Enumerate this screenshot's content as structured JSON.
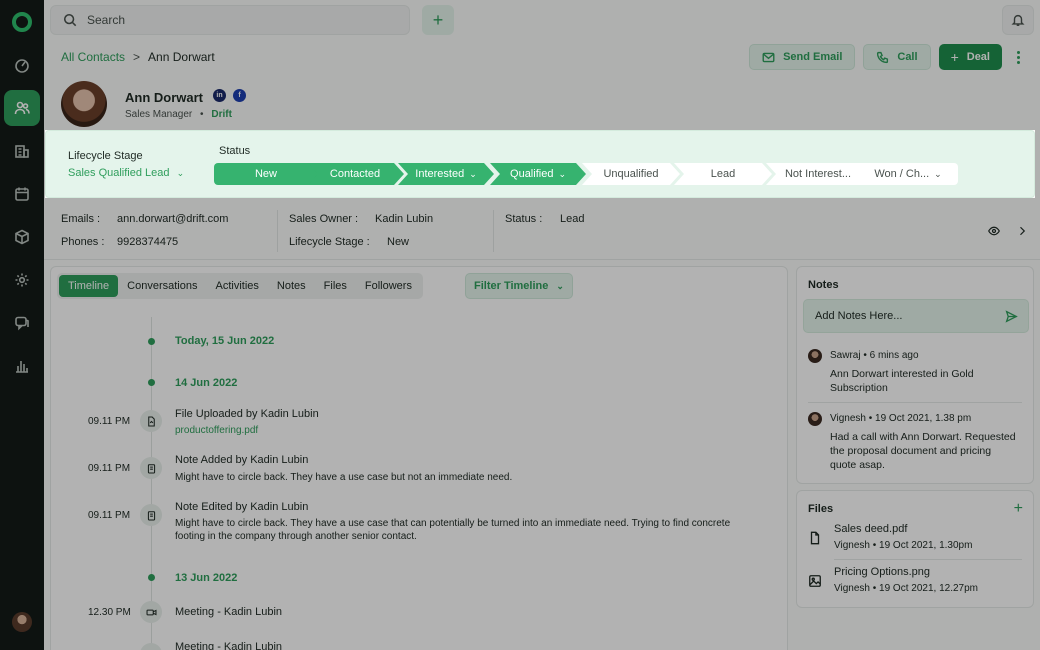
{
  "topbar": {
    "search_placeholder": "Search",
    "add_label": "+",
    "bell_icon": "bell-icon"
  },
  "breadcrumb": {
    "parent": "All Contacts",
    "separator": ">",
    "current": "Ann Dorwart"
  },
  "actions": {
    "send_email": "Send Email",
    "call": "Call",
    "deal": "Deal",
    "deal_plus": "+"
  },
  "profile": {
    "name": "Ann Dorwart",
    "role": "Sales Manager",
    "bullet": "•",
    "company": "Drift",
    "linkedin": "in",
    "facebook": "f"
  },
  "lifecycle": {
    "label": "Lifecycle Stage",
    "value": "Sales Qualified Lead",
    "status_label": "Status",
    "stages": [
      {
        "label": "New",
        "done": true,
        "dropdown": false
      },
      {
        "label": "Contacted",
        "done": true,
        "dropdown": false
      },
      {
        "label": "Interested",
        "done": true,
        "dropdown": true
      },
      {
        "label": "Qualified",
        "done": true,
        "dropdown": true
      },
      {
        "label": "Unqualified",
        "done": false,
        "dropdown": false
      },
      {
        "label": "Lead",
        "done": false,
        "dropdown": false
      },
      {
        "label": "Not Interest...",
        "done": false,
        "dropdown": false
      },
      {
        "label": "Won / Ch...",
        "done": false,
        "dropdown": true
      }
    ]
  },
  "info": {
    "emails_key": "Emails :",
    "emails_val": "ann.dorwart@drift.com",
    "phones_key": "Phones :",
    "phones_val": "9928374475",
    "owner_key": "Sales Owner :",
    "owner_val": "Kadin Lubin",
    "stage_key": "Lifecycle Stage :",
    "stage_val": "New",
    "status_key": "Status :",
    "status_val": "Lead"
  },
  "timeline": {
    "tabs": [
      "Timeline",
      "Conversations",
      "Activities",
      "Notes",
      "Files",
      "Followers"
    ],
    "filter_label": "Filter Timeline",
    "dates": [
      "Today, 15 Jun 2022",
      "14 Jun 2022",
      "13 Jun 2022"
    ],
    "events": [
      {
        "time": "09.11 PM",
        "title": "File Uploaded by Kadin Lubin",
        "sub": "productoffering.pdf",
        "desc": ""
      },
      {
        "time": "09.11 PM",
        "title": "Note Added by Kadin Lubin",
        "sub": "",
        "desc": "Might have to circle back. They have a use case but not an immediate need."
      },
      {
        "time": "09.11 PM",
        "title": "Note Edited by Kadin Lubin",
        "sub": "",
        "desc": "Might have to circle back. They have a use case that can potentially be turned into an immediate need. Trying to find concrete footing in the company through another senior contact."
      },
      {
        "time": "12.30 PM",
        "title": "Meeting - Kadin Lubin",
        "sub": "",
        "desc": ""
      },
      {
        "time": "",
        "title": "Meeting - Kadin Lubin",
        "sub": "",
        "desc": ""
      }
    ]
  },
  "notes": {
    "title": "Notes",
    "placeholder": "Add Notes Here...",
    "items": [
      {
        "author": "Sawraj",
        "meta": "• 6 mins ago",
        "text": "Ann Dorwart interested in Gold Subscription"
      },
      {
        "author": "Vignesh",
        "meta": "• 19 Oct 2021, 1.38 pm",
        "text": "Had a call with Ann Dorwart. Requested the proposal document and pricing quote asap."
      }
    ]
  },
  "files": {
    "title": "Files",
    "add": "+",
    "items": [
      {
        "name": "Sales deed.pdf",
        "author": "Vignesh",
        "meta": "• 19 Oct 2021, 1.30pm"
      },
      {
        "name": "Pricing Options.png",
        "author": "Vignesh",
        "meta": "• 19 Oct 2021, 12.27pm"
      }
    ]
  },
  "colors": {
    "accent": "#2f9e5c",
    "accent_light": "#e4f4eb",
    "sidebar": "#141a17",
    "stage_done": "#36b36f"
  }
}
